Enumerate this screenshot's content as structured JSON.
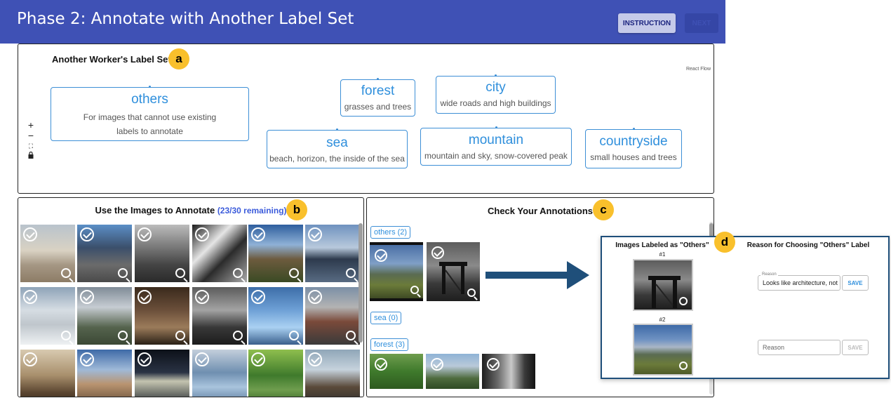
{
  "header": {
    "title": "Phase 2: Annotate with Another Label Set",
    "instruction_label": "INSTRUCTION",
    "next_label": "NEXT",
    "color": "#3f51b5"
  },
  "labelset": {
    "title": "Another Worker's Label Set",
    "badge": "a",
    "react_flow": "React Flow",
    "controls": [
      "+",
      "−",
      "⛶",
      "🔒"
    ],
    "nodes": [
      {
        "name": "others",
        "desc": "For images that cannot use existing labels to annotate"
      },
      {
        "name": "forest",
        "desc": "grasses and trees"
      },
      {
        "name": "city",
        "desc": "wide roads and high buildings"
      },
      {
        "name": "sea",
        "desc": "beach, horizon, the inside of the sea"
      },
      {
        "name": "mountain",
        "desc": "mountain and sky, snow-covered peak"
      },
      {
        "name": "countryside",
        "desc": "small houses and trees"
      }
    ]
  },
  "images_panel": {
    "title": "Use the Images to Annotate",
    "remaining": "(23/30 remaining)",
    "badge": "b"
  },
  "check_panel": {
    "title": "Check Your Annotations",
    "badge": "c",
    "groups": [
      {
        "label": "others (2)"
      },
      {
        "label": "sea (0)"
      },
      {
        "label": "forest (3)"
      }
    ]
  },
  "others_dialog": {
    "badge": "d",
    "col1_title": "Images Labeled as \"Others\"",
    "col2_title": "Reason for Choosing \"Others\" Label",
    "items": [
      {
        "num": "#1",
        "reason_legend": "Reason",
        "reason_value": "Looks like architecture, not",
        "save": "SAVE"
      },
      {
        "num": "#2",
        "reason_placeholder": "Reason",
        "save": "SAVE"
      }
    ]
  },
  "colors": {
    "accent_blue": "#2f8fdc",
    "badge_yellow": "#f9c02c",
    "arrow_navy": "#1f4f7a"
  }
}
